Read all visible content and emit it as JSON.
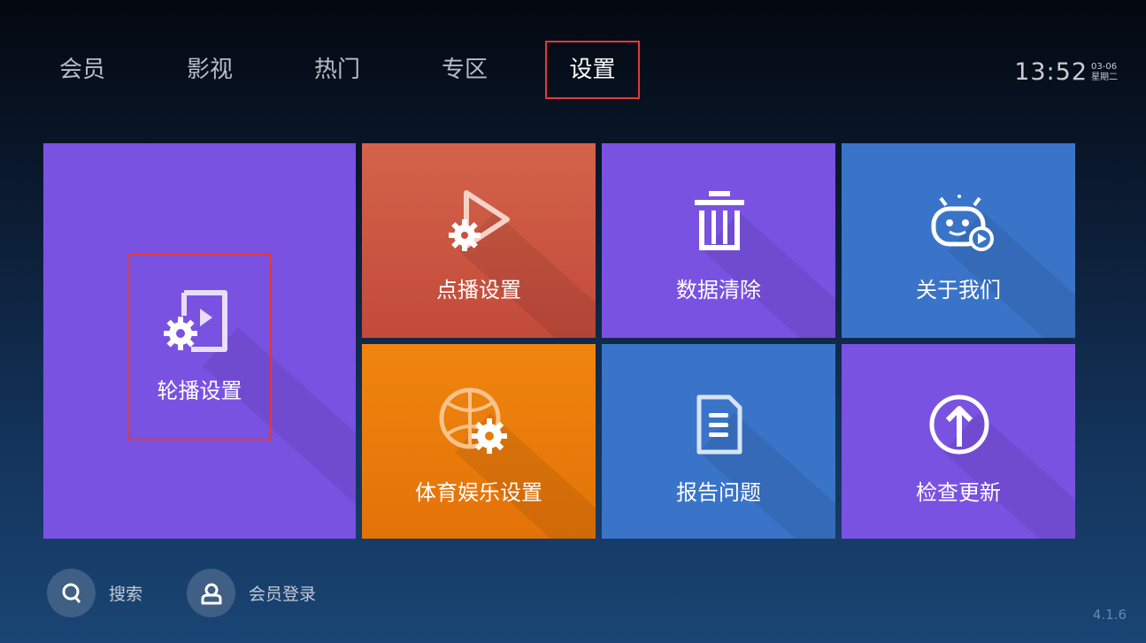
{
  "nav": {
    "items": [
      {
        "label": "会员"
      },
      {
        "label": "影视"
      },
      {
        "label": "热门"
      },
      {
        "label": "专区"
      },
      {
        "label": "设置"
      }
    ],
    "active": "设置"
  },
  "clock": {
    "time": "13:52",
    "date": "03-06",
    "weekday": "星期二"
  },
  "tiles": {
    "lunbo": {
      "label": "轮播设置",
      "icon": "carousel-settings-icon"
    },
    "dianbo": {
      "label": "点播设置",
      "icon": "play-settings-icon"
    },
    "shuju": {
      "label": "数据清除",
      "icon": "trash-icon"
    },
    "guanyu": {
      "label": "关于我们",
      "icon": "robot-play-icon"
    },
    "tiyu": {
      "label": "体育娱乐设置",
      "icon": "basketball-settings-icon"
    },
    "baogao": {
      "label": "报告问题",
      "icon": "document-icon"
    },
    "jiancha": {
      "label": "检查更新",
      "icon": "upload-arrow-icon"
    }
  },
  "bottom": {
    "search": {
      "label": "搜索",
      "icon": "search-icon"
    },
    "login": {
      "label": "会员登录",
      "icon": "user-icon"
    }
  },
  "version": "4.1.6",
  "colors": {
    "purple": "#7a52e2",
    "red": "#c8543f",
    "blue": "#3a74c8",
    "orange": "#ec7d0b",
    "focus": "#e03a3a"
  }
}
